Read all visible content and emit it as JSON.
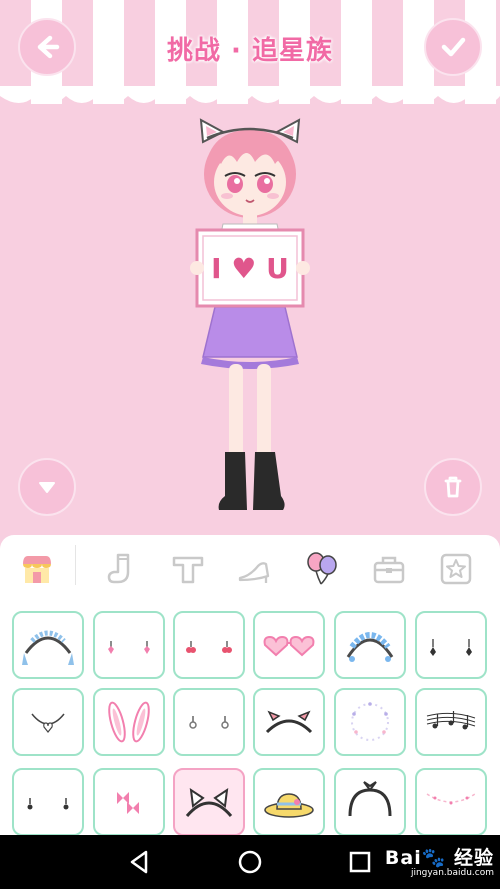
{
  "header": {
    "title": "挑战 · 追星族",
    "back_icon": "arrow-left-icon",
    "confirm_icon": "checkmark-icon"
  },
  "character": {
    "sign_text": "I ♥ U"
  },
  "controls": {
    "collapse_icon": "triangle-down-icon",
    "delete_icon": "trash-icon"
  },
  "category_tabs": [
    {
      "name": "shop-icon",
      "active": true
    },
    {
      "name": "sock-icon",
      "active": false
    },
    {
      "name": "top-icon",
      "active": false
    },
    {
      "name": "shoe-icon",
      "active": false
    },
    {
      "name": "balloon-icon",
      "active": false
    },
    {
      "name": "bag-icon",
      "active": false
    },
    {
      "name": "star-icon",
      "active": false
    }
  ],
  "items": [
    {
      "name": "maid-headband-icon"
    },
    {
      "name": "pink-earrings-icon"
    },
    {
      "name": "cherry-earrings-icon"
    },
    {
      "name": "heart-glasses-icon"
    },
    {
      "name": "lace-headband-icon"
    },
    {
      "name": "drop-earrings-icon"
    },
    {
      "name": "heart-necklace-icon"
    },
    {
      "name": "bunny-ears-icon"
    },
    {
      "name": "small-earrings-icon"
    },
    {
      "name": "bow-headband-icon"
    },
    {
      "name": "sparkle-halo-icon"
    },
    {
      "name": "music-notes-icon"
    },
    {
      "name": "stud-earrings-icon"
    },
    {
      "name": "bow-clips-icon"
    },
    {
      "name": "cat-ears-icon"
    },
    {
      "name": "straw-hat-icon"
    },
    {
      "name": "bandana-headband-icon"
    },
    {
      "name": "happy-birthday-icon"
    }
  ],
  "selected_item": "cat-ears-icon",
  "watermark": {
    "brand": "Bai🐾 经验",
    "url": "jingyan.baidu.com"
  },
  "colors": {
    "accent": "#f16aa5",
    "background": "#f8cfe0",
    "cell_border": "#9ee3c8",
    "selected_border": "#f4a3c4"
  }
}
